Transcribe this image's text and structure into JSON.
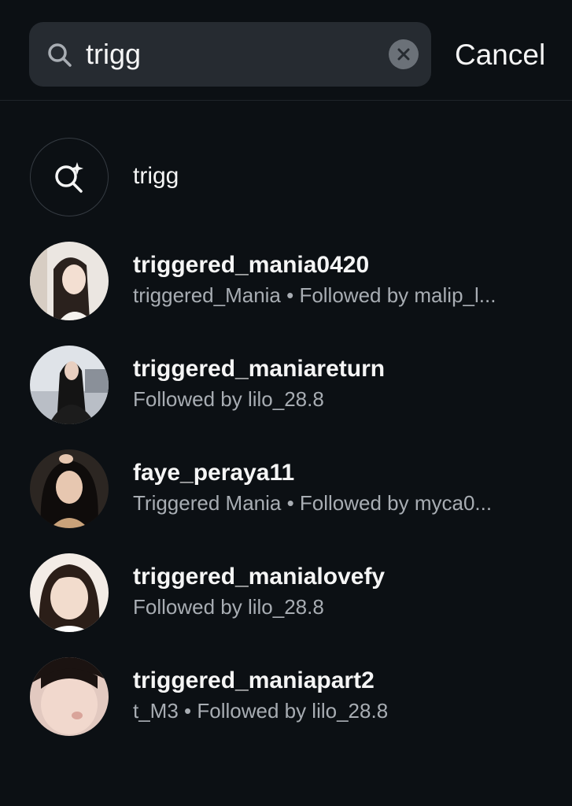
{
  "search": {
    "query": "trigg",
    "cancel_label": "Cancel"
  },
  "suggestion": {
    "text": "trigg",
    "icon": "search-sparkle-icon"
  },
  "results": [
    {
      "username": "triggered_mania0420",
      "subtitle": "triggered_Mania • Followed by malip_l...",
      "avatar_colors": [
        "#f1ede9",
        "#2a211d"
      ]
    },
    {
      "username": "triggered_maniareturn",
      "subtitle": "Followed by lilo_28.8",
      "avatar_colors": [
        "#d9dde3",
        "#141414"
      ]
    },
    {
      "username": "faye_peraya11",
      "subtitle": "Triggered Mania • Followed by myca0...",
      "avatar_colors": [
        "#3d3530",
        "#0f0c0b"
      ]
    },
    {
      "username": "triggered_manialovefy",
      "subtitle": "Followed by lilo_28.8",
      "avatar_colors": [
        "#f3ece6",
        "#2b1e18"
      ]
    },
    {
      "username": "triggered_maniapart2",
      "subtitle": "t_M3 • Followed by lilo_28.8",
      "avatar_colors": [
        "#e9d6cf",
        "#1b1311"
      ]
    }
  ],
  "colors": {
    "background": "#0c1014",
    "search_field": "#262b31",
    "secondary_text": "#a8adb3"
  }
}
